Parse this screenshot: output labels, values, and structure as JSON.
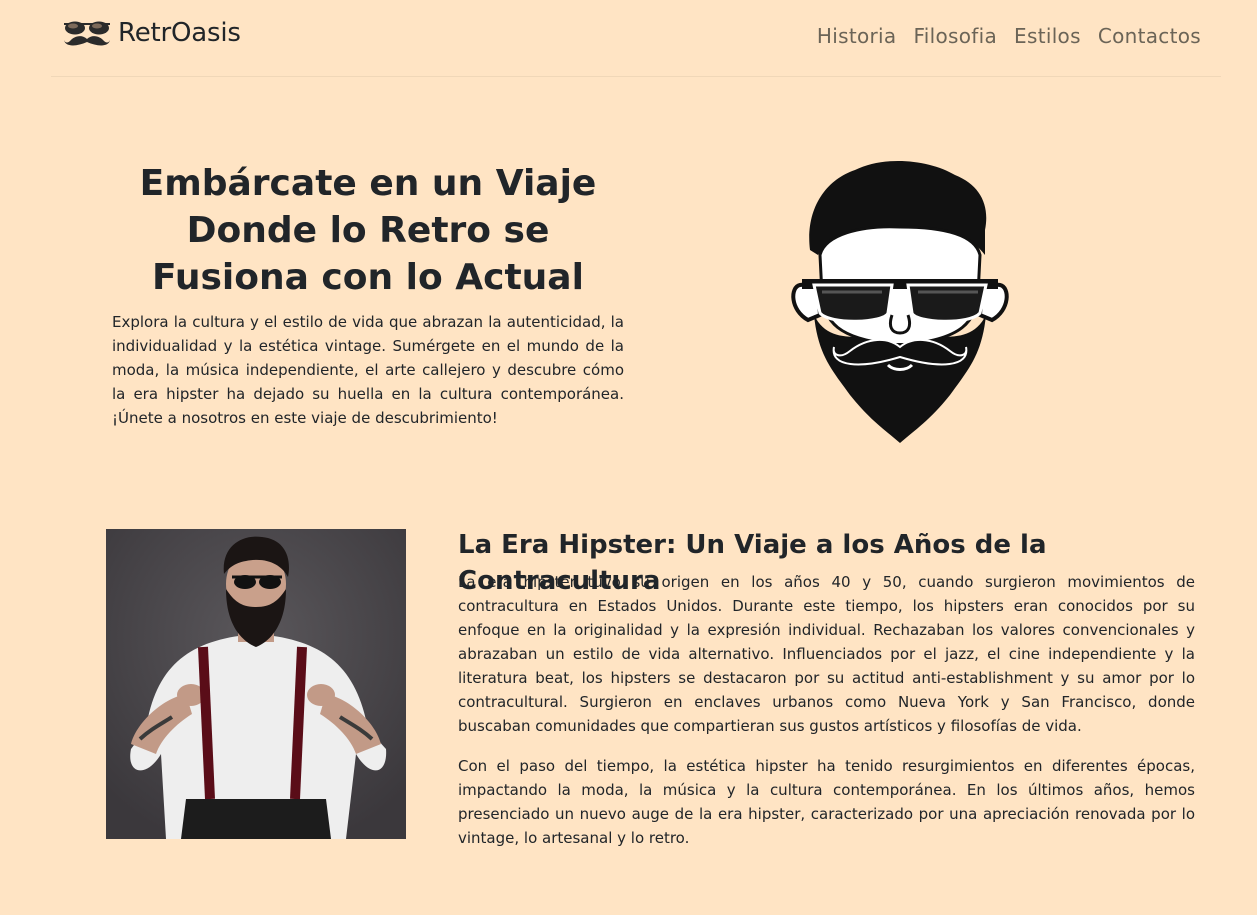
{
  "brand": {
    "name": "RetrOasis",
    "logo_icon": "sunglasses-mustache-icon"
  },
  "nav": {
    "items": [
      {
        "label": "Historia"
      },
      {
        "label": "Filosofia"
      },
      {
        "label": "Estilos"
      },
      {
        "label": "Contactos"
      }
    ]
  },
  "hero": {
    "title": "Embárcate en un Viaje Donde lo Retro se Fusiona con lo Actual",
    "text": "Explora la cultura y el estilo de vida que abrazan la autenticidad, la individualidad y la estética vintage. Sumérgete en el mundo de la moda, la música independiente, el arte callejero y descubre cómo la era hipster ha dejado su huella en la cultura contemporánea. ¡Únete a nosotros en este viaje de descubrimiento!",
    "image_icon": "bearded-hipster-face-icon"
  },
  "section": {
    "image_icon": "hipster-man-photo",
    "title": "La Era Hipster: Un Viaje a los Años de la Contracultura",
    "paragraph1": "La era hipster tuvo su origen en los años 40 y 50, cuando surgieron movimientos de contracultura en Estados Unidos. Durante este tiempo, los hipsters eran conocidos por su enfoque en la originalidad y la expresión individual. Rechazaban los valores convencionales y abrazaban un estilo de vida alternativo. Influenciados por el jazz, el cine independiente y la literatura beat, los hipsters se destacaron por su actitud anti-establishment y su amor por lo contracultural. Surgieron en enclaves urbanos como Nueva York y San Francisco, donde buscaban comunidades que compartieran sus gustos artísticos y filosofías de vida.",
    "paragraph2": "Con el paso del tiempo, la estética hipster ha tenido resurgimientos en diferentes épocas, impactando la moda, la música y la cultura contemporánea. En los últimos años, hemos presenciado un nuevo auge de la era hipster, caracterizado por una apreciación renovada por lo vintage, lo artesanal y lo retro."
  },
  "colors": {
    "background": "#ffe4c4",
    "text": "#212529",
    "nav_text": "#6b6457"
  }
}
